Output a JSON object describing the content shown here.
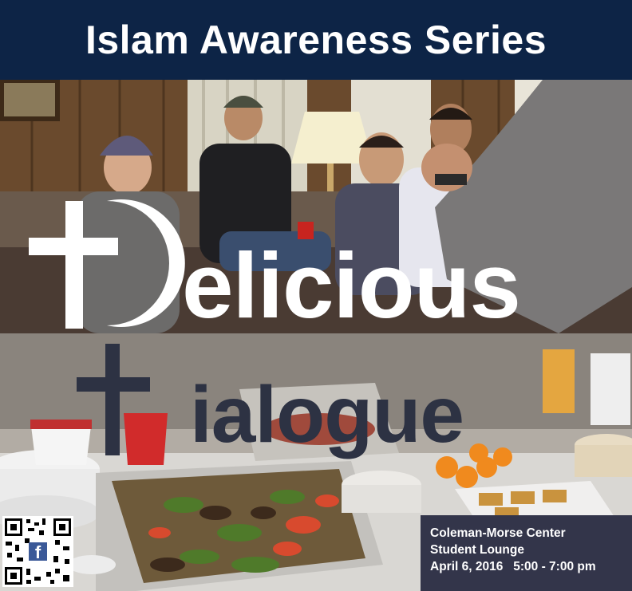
{
  "header": {
    "title": "Islam Awareness Series"
  },
  "title": {
    "word1_rest": "elicious",
    "word2_rest": "ialogue"
  },
  "event": {
    "location_line1": "Coleman-Morse Center",
    "location_line2": "Student Lounge",
    "date": "April 6, 2016",
    "time": "5:00 - 7:00 pm"
  },
  "colors": {
    "header_bg": "#0d2446",
    "info_bg": "#33354a",
    "dialogue_text": "#2d3243"
  },
  "icons": [
    "qr-code-icon",
    "facebook-icon",
    "cross-crescent-logo-icon"
  ]
}
